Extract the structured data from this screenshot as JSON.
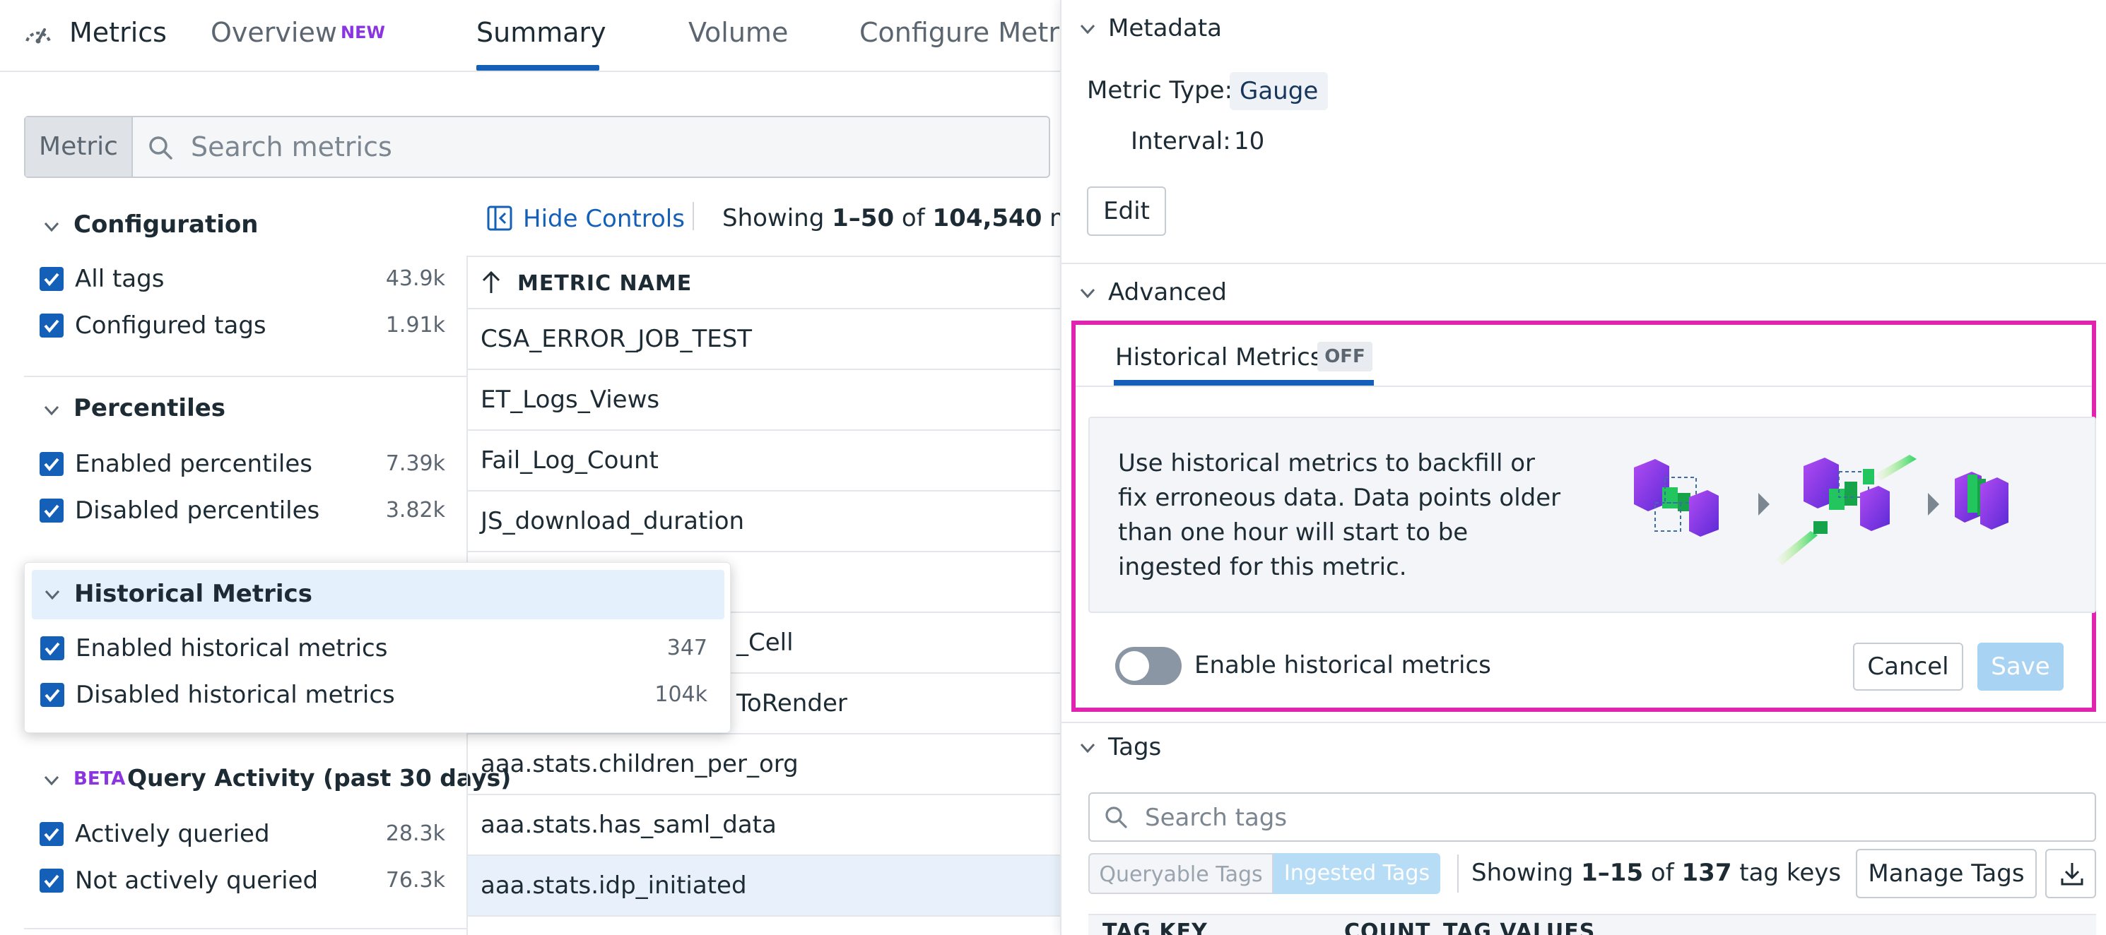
{
  "nav": {
    "app_name": "Metrics",
    "tabs": [
      {
        "label": "Overview",
        "badge": "NEW"
      },
      {
        "label": "Summary"
      },
      {
        "label": "Volume"
      },
      {
        "label": "Configure Metrics"
      }
    ]
  },
  "search": {
    "chip": "Metric",
    "placeholder": "Search metrics"
  },
  "facets": {
    "configuration": {
      "title": "Configuration",
      "items": [
        {
          "label": "All tags",
          "count": "43.9k",
          "checked": true
        },
        {
          "label": "Configured tags",
          "count": "1.91k",
          "checked": true
        }
      ]
    },
    "percentiles": {
      "title": "Percentiles",
      "items": [
        {
          "label": "Enabled percentiles",
          "count": "7.39k",
          "checked": true
        },
        {
          "label": "Disabled percentiles",
          "count": "3.82k",
          "checked": true
        }
      ]
    },
    "historical": {
      "title": "Historical Metrics",
      "items": [
        {
          "label": "Enabled historical metrics",
          "count": "347",
          "checked": true
        },
        {
          "label": "Disabled historical metrics",
          "count": "104k",
          "checked": true
        }
      ]
    },
    "query_activity": {
      "beta": "BETA",
      "title": "Query Activity (past 30 days)",
      "items": [
        {
          "label": "Actively queried",
          "count": "28.3k",
          "checked": true
        },
        {
          "label": "Not actively queried",
          "count": "76.3k",
          "checked": true
        }
      ]
    }
  },
  "list": {
    "hide_controls": "Hide Controls",
    "showing_prefix": "Showing ",
    "showing_range": "1–50",
    "showing_of": " of ",
    "showing_total": "104,540",
    "showing_suffix": " metri",
    "column": "METRIC NAME",
    "rows": [
      "CSA_ERROR_JOB_TEST",
      "ET_Logs_Views",
      "Fail_Log_Count",
      "JS_download_duration",
      "",
      "_Cell",
      "ToRender",
      "aaa.stats.children_per_org",
      "aaa.stats.has_saml_data",
      "aaa.stats.idp_initiated"
    ],
    "selected_row": 9
  },
  "panel": {
    "metadata": {
      "title": "Metadata",
      "type_label": "Metric Type:",
      "type_value": "Gauge",
      "interval_label": "Interval:",
      "interval_value": "10",
      "edit": "Edit"
    },
    "advanced": {
      "title": "Advanced",
      "tab": "Historical Metrics",
      "status": "OFF",
      "description": "Use historical metrics to backfill or fix erroneous data. Data points older than one hour will start to be ingested for this metric.",
      "toggle_label": "Enable historical metrics",
      "toggle_on": false,
      "cancel": "Cancel",
      "save": "Save"
    },
    "tags": {
      "title": "Tags",
      "search_placeholder": "Search tags",
      "queryable": "Queryable Tags",
      "ingested": "Ingested Tags",
      "showing_prefix": "Showing ",
      "showing_range": "1–15",
      "showing_of": " of ",
      "showing_total": "137",
      "showing_suffix": " tag keys",
      "manage": "Manage Tags",
      "columns": [
        "TAG KEY",
        "COUNT",
        "TAG VALUES"
      ]
    }
  },
  "colors": {
    "accent": "#1460b8",
    "highlight": "#e024b0",
    "beta": "#8a35e0"
  }
}
